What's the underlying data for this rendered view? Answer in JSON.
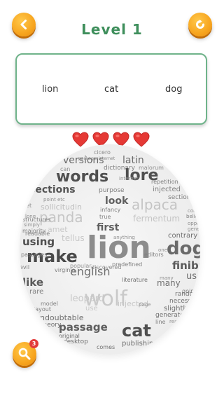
{
  "level": {
    "title": "Level 1"
  },
  "targets": [
    "lion",
    "cat",
    "dog"
  ],
  "lives": {
    "count": 4,
    "color": "#e53935"
  },
  "hint": {
    "count": "3"
  },
  "colors": {
    "accent": "#f7a51f",
    "title": "#3f8f5c",
    "box_border": "#6fb38a"
  },
  "cloud": {
    "words": [
      {
        "text": "cicero",
        "cls": "g5"
      },
      {
        "text": "packagesinternet",
        "cls": "g7"
      },
      {
        "text": "versions",
        "cls": "g1"
      },
      {
        "text": "latin",
        "cls": "g1"
      },
      {
        "text": "dictionary",
        "cls": "g3"
      },
      {
        "text": "malorum",
        "cls": "g5"
      },
      {
        "text": "words",
        "cls": "d1"
      },
      {
        "text": "lore",
        "cls": "d1"
      },
      {
        "text": "repetition",
        "cls": "g3"
      },
      {
        "text": "injected",
        "cls": "g3"
      },
      {
        "text": "sections",
        "cls": "g1"
      },
      {
        "text": "purpose",
        "cls": "g3"
      },
      {
        "text": "section",
        "cls": "g3"
      },
      {
        "text": "alpaca",
        "cls": "l1"
      },
      {
        "text": "look",
        "cls": "d2"
      },
      {
        "text": "sollicitudin",
        "cls": "l2"
      },
      {
        "text": "panda",
        "cls": "l1"
      },
      {
        "text": "infancy",
        "cls": "g3"
      },
      {
        "text": "fermentum",
        "cls": "l2"
      },
      {
        "text": "amet",
        "cls": "l2"
      },
      {
        "text": "first",
        "cls": "d2"
      },
      {
        "text": "belief",
        "cls": "g5"
      },
      {
        "text": "contrary",
        "cls": "g3"
      },
      {
        "text": "lion",
        "cls": "d0"
      },
      {
        "text": "dog",
        "cls": "d1"
      },
      {
        "text": "using",
        "cls": "d2"
      },
      {
        "text": "make",
        "cls": "d1"
      },
      {
        "text": "finibus",
        "cls": "d2"
      },
      {
        "text": "english",
        "cls": "g1"
      },
      {
        "text": "like",
        "cls": "d2"
      },
      {
        "text": "use",
        "cls": "g2"
      },
      {
        "text": "many",
        "cls": "g2"
      },
      {
        "text": "wolf",
        "cls": "l1"
      },
      {
        "text": "random",
        "cls": "g3"
      },
      {
        "text": "necessary",
        "cls": "g3"
      },
      {
        "text": "literature",
        "cls": "g3"
      },
      {
        "text": "passage",
        "cls": "d2"
      },
      {
        "text": "cat",
        "cls": "d1"
      },
      {
        "text": "generate",
        "cls": "g3"
      },
      {
        "text": "publishing",
        "cls": "g3"
      },
      {
        "text": "desktop",
        "cls": "g3"
      },
      {
        "text": "theory",
        "cls": "g3"
      },
      {
        "text": "leopard",
        "cls": "l2"
      },
      {
        "text": "slightly",
        "cls": "g3"
      },
      {
        "text": "original",
        "cls": "g4"
      },
      {
        "text": "undoubtable",
        "cls": "g3"
      },
      {
        "text": "comes",
        "cls": "g4"
      },
      {
        "text": "popular",
        "cls": "g4"
      },
      {
        "text": "discovered",
        "cls": "g4"
      },
      {
        "text": "readable",
        "cls": "g4"
      },
      {
        "text": "passages",
        "cls": "g4"
      },
      {
        "text": "structures",
        "cls": "g3"
      },
      {
        "text": "layout",
        "cls": "g4"
      },
      {
        "text": "model",
        "cls": "g4"
      },
      {
        "text": "rare",
        "cls": "g3"
      },
      {
        "text": "evil",
        "cls": "g4"
      },
      {
        "text": "virginia",
        "cls": "g4"
      },
      {
        "text": "predefined",
        "cls": "g4"
      },
      {
        "text": "editors",
        "cls": "g4"
      },
      {
        "text": "going",
        "cls": "g4"
      },
      {
        "text": "line",
        "cls": "g4"
      },
      {
        "text": "reader",
        "cls": "g5"
      },
      {
        "text": "simply",
        "cls": "g4"
      },
      {
        "text": "majority",
        "cls": "g4"
      },
      {
        "text": "long",
        "cls": "g4"
      },
      {
        "text": "point",
        "cls": "g4"
      },
      {
        "text": "true",
        "cls": "g4"
      },
      {
        "text": "anything",
        "cls": "g4"
      },
      {
        "text": "generated",
        "cls": "g5"
      },
      {
        "text": "opposed",
        "cls": "g5"
      },
      {
        "text": "content",
        "cls": "g5"
      },
      {
        "text": "tellus",
        "cls": "l2"
      },
      {
        "text": "injected",
        "cls": "l2"
      },
      {
        "text": "internet",
        "cls": "g5"
      },
      {
        "text": "etc",
        "cls": "g5"
      },
      {
        "text": "can",
        "cls": "g5"
      },
      {
        "text": "get",
        "cls": "g5"
      },
      {
        "text": "page",
        "cls": "g5"
      },
      {
        "text": "one",
        "cls": "g5"
      },
      {
        "text": "many",
        "cls": "g5"
      },
      {
        "text": "use",
        "cls": "l2"
      }
    ]
  }
}
